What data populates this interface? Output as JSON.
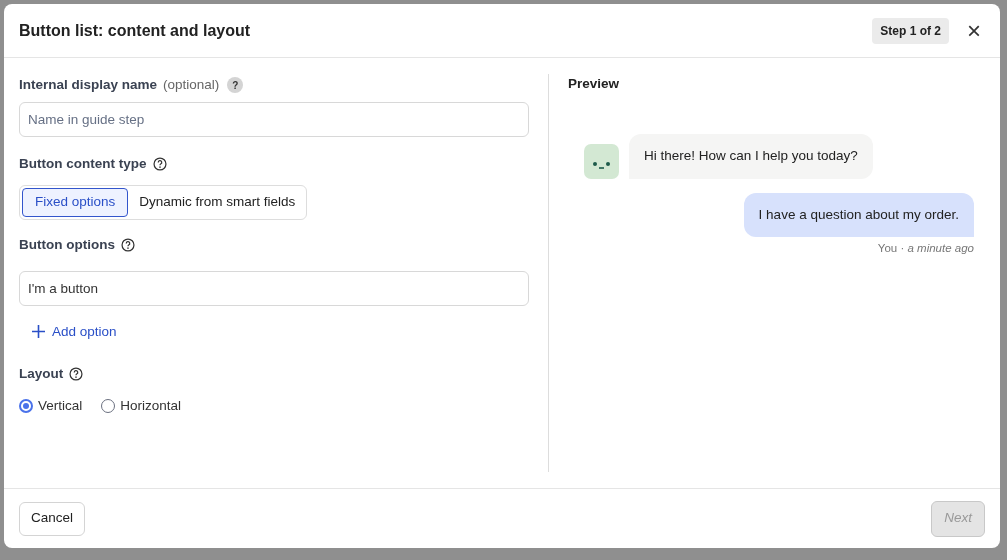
{
  "dialog": {
    "title": "Button list: content and layout",
    "step": "Step 1 of 2",
    "close": "×"
  },
  "form": {
    "display_name": {
      "label": "Internal display name",
      "hint": "(optional)",
      "help": "?",
      "placeholder": "Name in guide step"
    },
    "content_type": {
      "label": "Button content type",
      "options": [
        {
          "label": "Fixed options",
          "selected": true
        },
        {
          "label": "Dynamic from smart fields",
          "selected": false
        }
      ]
    },
    "button_options": {
      "label": "Button options",
      "values": [
        "I'm a button"
      ],
      "add": "Add option"
    },
    "layout": {
      "label": "Layout",
      "options": [
        {
          "label": "Vertical",
          "selected": true
        },
        {
          "label": "Horizontal",
          "selected": false
        }
      ]
    }
  },
  "preview": {
    "title": "Preview",
    "messages": [
      {
        "kind": "bot",
        "text": "Hi there! How can I help you today?"
      },
      {
        "kind": "user",
        "text": "I have a question about my order.",
        "author": "You",
        "separator": "·",
        "time": "a minute ago"
      }
    ]
  },
  "footer": {
    "cancel": "Cancel",
    "next": {
      "label": "Next",
      "disabled": true
    }
  }
}
